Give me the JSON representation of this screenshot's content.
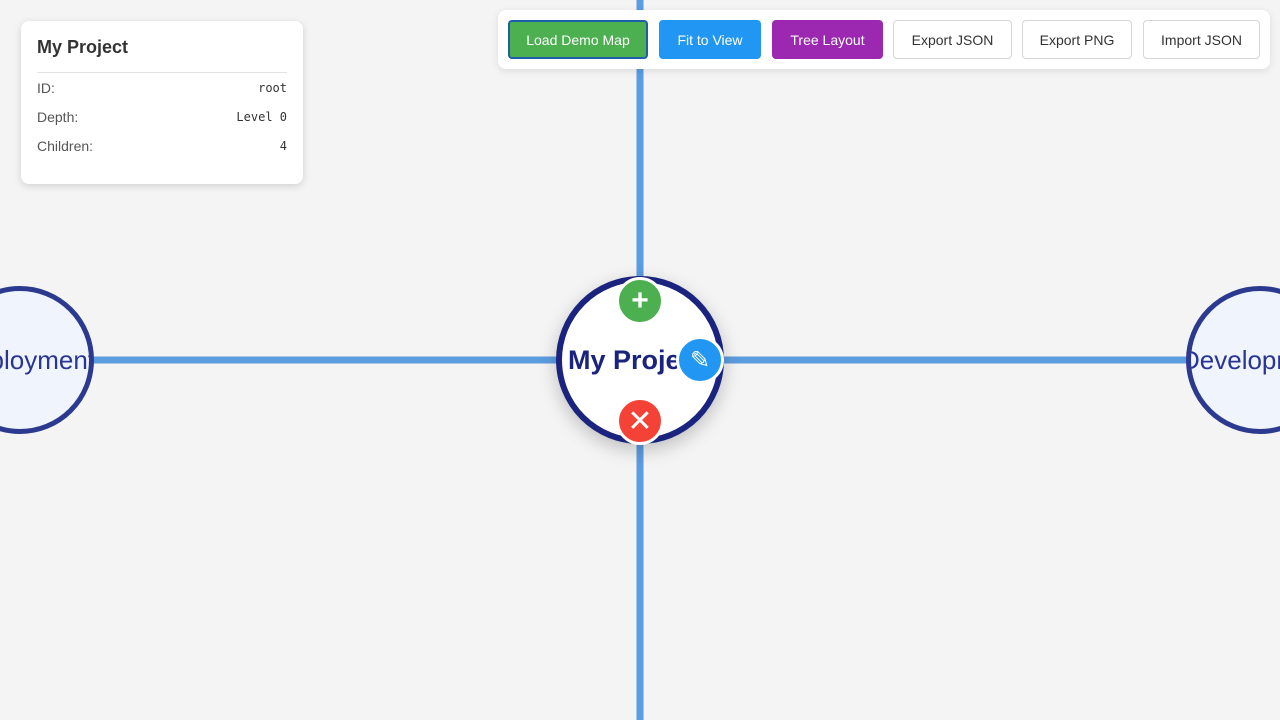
{
  "colors": {
    "background": "#f4f4f4",
    "edge": "#5c9ce0",
    "node_border": "#1a237e",
    "add": "#4caf50",
    "edit": "#2196f3",
    "delete": "#f44336"
  },
  "info_panel": {
    "title": "My Project",
    "rows": [
      {
        "label": "ID:",
        "value": "root"
      },
      {
        "label": "Depth:",
        "value": "Level 0"
      },
      {
        "label": "Children:",
        "value": "4"
      }
    ]
  },
  "toolbar": {
    "load_demo": "Load Demo Map",
    "fit_view": "Fit to View",
    "tree_layout": "Tree Layout",
    "export_json": "Export JSON",
    "export_png": "Export PNG",
    "import_json": "Import JSON"
  },
  "nodes": {
    "root": "My Project",
    "left": "Deployment",
    "right": "Development"
  },
  "node_actions": {
    "add_icon": "plus-icon",
    "edit_icon": "pencil-icon",
    "delete_icon": "close-icon"
  }
}
